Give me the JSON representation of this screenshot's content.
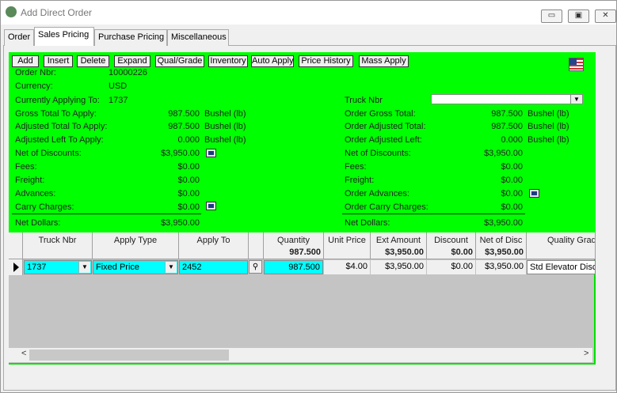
{
  "window": {
    "title": "Add Direct Order",
    "minimize": "▭",
    "maximize": "▣",
    "close": "✕"
  },
  "tabs": [
    "Order",
    "Sales Pricing",
    "Purchase Pricing",
    "Miscellaneous"
  ],
  "toolbar": [
    "Add",
    "Insert",
    "Delete",
    "Expand",
    "Qual/Grade",
    "Inventory",
    "Auto Apply",
    "Price History",
    "Mass Apply"
  ],
  "left": {
    "order_nbr_label": "Order Nbr:",
    "order_nbr": "10000226",
    "currency_label": "Currency:",
    "currency": "USD",
    "applying_label": "Currently Applying To:",
    "applying": "1737",
    "gross_label": "Gross Total To Apply:",
    "gross": "987.500",
    "gross_unit": "Bushel (lb)",
    "adjusted_label": "Adjusted Total To Apply:",
    "adjusted": "987.500",
    "adjusted_unit": "Bushel (lb)",
    "adjleft_label": "Adjusted Left To Apply:",
    "adjleft": "0.000",
    "adjleft_unit": "Bushel (lb)",
    "net_disc_label": "Net of Discounts:",
    "net_disc": "$3,950.00",
    "fees_label": "Fees:",
    "fees": "$0.00",
    "freight_label": "Freight:",
    "freight": "$0.00",
    "advances_label": "Advances:",
    "advances": "$0.00",
    "carry_label": "Carry Charges:",
    "carry": "$0.00",
    "net_dollars_label": "Net Dollars:",
    "net_dollars": "$3,950.00"
  },
  "right": {
    "truck_label": "Truck Nbr",
    "gross_label": "Order Gross Total:",
    "gross": "987.500",
    "gross_unit": "Bushel (lb)",
    "adjusted_label": "Order Adjusted Total:",
    "adjusted": "987.500",
    "adjusted_unit": "Bushel (lb)",
    "adjleft_label": "Order Adjusted Left:",
    "adjleft": "0.000",
    "adjleft_unit": "Bushel (lb)",
    "net_disc_label": "Net of Discounts:",
    "net_disc": "$3,950.00",
    "fees_label": "Fees:",
    "fees": "$0.00",
    "freight_label": "Freight:",
    "freight": "$0.00",
    "advances_label": "Order Advances:",
    "advances": "$0.00",
    "carry_label": "Order Carry Charges:",
    "carry": "$0.00",
    "net_dollars_label": "Net Dollars:",
    "net_dollars": "$3,950.00"
  },
  "grid": {
    "headers": [
      "Truck Nbr",
      "Apply Type",
      "Apply To",
      "Quantity",
      "Unit Price",
      "Ext Amount",
      "Discount",
      "Net of Disc",
      "Quality Grad"
    ],
    "totals": {
      "quantity": "987.500",
      "ext_amount": "$3,950.00",
      "discount": "$0.00",
      "net_of_disc": "$3,950.00"
    },
    "row": {
      "truck_nbr": "1737",
      "apply_type": "Fixed Price",
      "apply_to": "2452",
      "quantity": "987.500",
      "unit_price": "$4.00",
      "ext_amount": "$3,950.00",
      "discount": "$0.00",
      "net_of_disc": "$3,950.00",
      "quality": "Std Elevator Disc"
    }
  },
  "scroll": {
    "left": "<",
    "right": ">"
  },
  "colors": {
    "panel": "#00ff00",
    "editable": "#00ffff"
  }
}
